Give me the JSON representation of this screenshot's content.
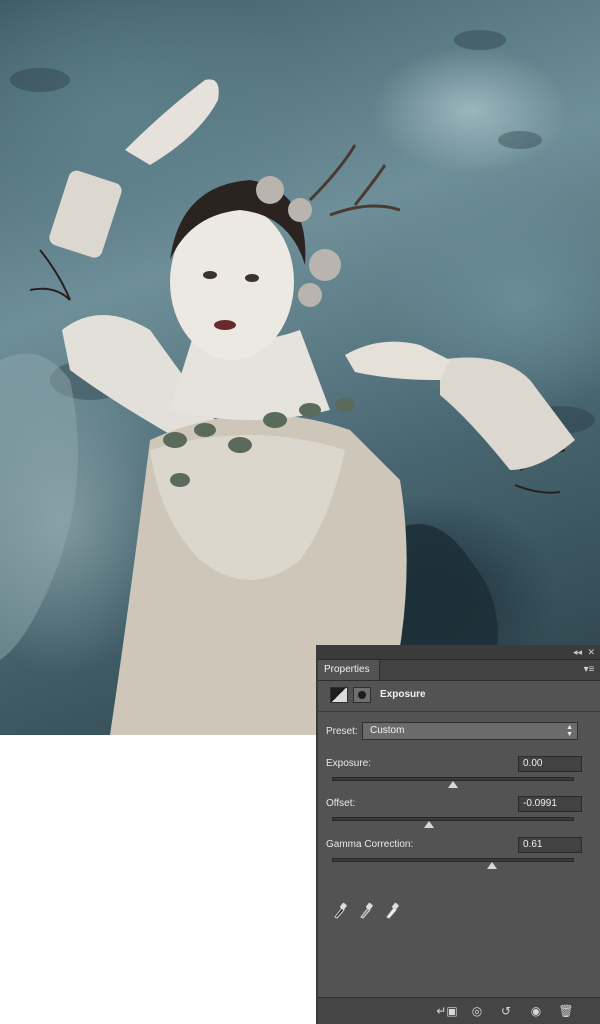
{
  "panel": {
    "collapse_glyph": "◂◂",
    "close_glyph": "✕",
    "tab_label": "Properties",
    "menu_glyph": "▾≡",
    "adjustment_title": "Exposure",
    "preset": {
      "label": "Preset:",
      "value": "Custom"
    },
    "fields": [
      {
        "label": "Exposure:",
        "value": "0.00",
        "slider_fraction": 0.5
      },
      {
        "label": "Offset:",
        "value": "-0.0991",
        "slider_fraction": 0.4
      },
      {
        "label": "Gamma Correction:",
        "value": "0.61",
        "slider_fraction": 0.66
      }
    ],
    "eyedroppers": [
      "black-point-eyedropper-icon",
      "gray-point-eyedropper-icon",
      "white-point-eyedropper-icon"
    ],
    "bottom_buttons": [
      {
        "name": "clip-to-layer-icon",
        "glyph": "↵▣"
      },
      {
        "name": "view-previous-state-icon",
        "glyph": "◎"
      },
      {
        "name": "reset-icon",
        "glyph": "↺"
      },
      {
        "name": "visibility-icon",
        "glyph": "◉"
      },
      {
        "name": "trash-icon",
        "glyph": "🗑"
      }
    ]
  }
}
